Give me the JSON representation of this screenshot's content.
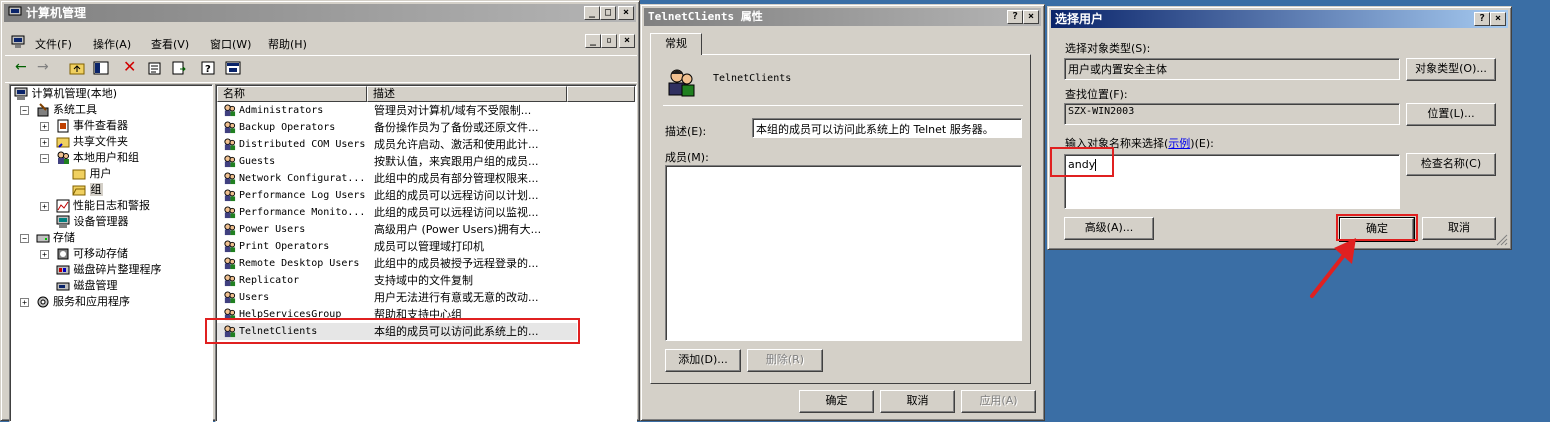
{
  "mmc": {
    "title": "计算机管理",
    "menu": [
      "文件(F)",
      "操作(A)",
      "查看(V)",
      "窗口(W)",
      "帮助(H)"
    ],
    "tree": [
      {
        "label": "计算机管理(本地)",
        "level": 0
      },
      {
        "label": "系统工具",
        "level": 1
      },
      {
        "label": "事件查看器",
        "level": 2
      },
      {
        "label": "共享文件夹",
        "level": 2
      },
      {
        "label": "本地用户和组",
        "level": 2
      },
      {
        "label": "用户",
        "level": 3
      },
      {
        "label": "组",
        "level": 3
      },
      {
        "label": "性能日志和警报",
        "level": 2
      },
      {
        "label": "设备管理器",
        "level": 2
      },
      {
        "label": "存储",
        "level": 1
      },
      {
        "label": "可移动存储",
        "level": 2
      },
      {
        "label": "磁盘碎片整理程序",
        "level": 2
      },
      {
        "label": "磁盘管理",
        "level": 2
      },
      {
        "label": "服务和应用程序",
        "level": 1
      }
    ],
    "columns": {
      "name": "名称",
      "description": "描述"
    },
    "groups": [
      {
        "name": "Administrators",
        "desc": "管理员对计算机/域有不受限制..."
      },
      {
        "name": "Backup Operators",
        "desc": "备份操作员为了备份或还原文件..."
      },
      {
        "name": "Distributed COM Users",
        "desc": "成员允许启动、激活和使用此计..."
      },
      {
        "name": "Guests",
        "desc": "按默认值，来宾跟用户组的成员..."
      },
      {
        "name": "Network Configurat...",
        "desc": "此组中的成员有部分管理权限来..."
      },
      {
        "name": "Performance Log Users",
        "desc": "此组的成员可以远程访问以计划..."
      },
      {
        "name": "Performance Monito...",
        "desc": "此组的成员可以远程访问以监视..."
      },
      {
        "name": "Power Users",
        "desc": "高级用户 (Power Users)拥有大..."
      },
      {
        "name": "Print Operators",
        "desc": "成员可以管理域打印机"
      },
      {
        "name": "Remote Desktop Users",
        "desc": "此组中的成员被授予远程登录的..."
      },
      {
        "name": "Replicator",
        "desc": "支持域中的文件复制"
      },
      {
        "name": "Users",
        "desc": "用户无法进行有意或无意的改动..."
      },
      {
        "name": "HelpServicesGroup",
        "desc": "帮助和支持中心组"
      },
      {
        "name": "TelnetClients",
        "desc": "本组的成员可以访问此系统上的..."
      }
    ]
  },
  "props": {
    "title": "TelnetClients 属性",
    "tab": "常规",
    "group_name": "TelnetClients",
    "desc_label": "描述(E):",
    "desc_value": "本组的成员可以访问此系统上的 Telnet 服务器。",
    "members_label": "成员(M):",
    "add": "添加(D)...",
    "remove": "删除(R)",
    "ok": "确定",
    "cancel": "取消",
    "apply": "应用(A)"
  },
  "select": {
    "title": "选择用户",
    "obj_type_label": "选择对象类型(S):",
    "obj_type_value": "用户或内置安全主体",
    "obj_type_btn": "对象类型(O)...",
    "location_label": "查找位置(F):",
    "location_value": "SZX-WIN2003",
    "location_btn": "位置(L)...",
    "names_label_a": "输入对象名称来选择(",
    "names_link": "示例",
    "names_label_b": ")(E):",
    "names_value": "andy",
    "check_btn": "检查名称(C)",
    "advanced_btn": "高级(A)...",
    "ok": "确定",
    "cancel": "取消"
  },
  "colors": {
    "desktop": "#3a6ea5",
    "annotation": "#e02020",
    "active_title": "#0a246a"
  }
}
